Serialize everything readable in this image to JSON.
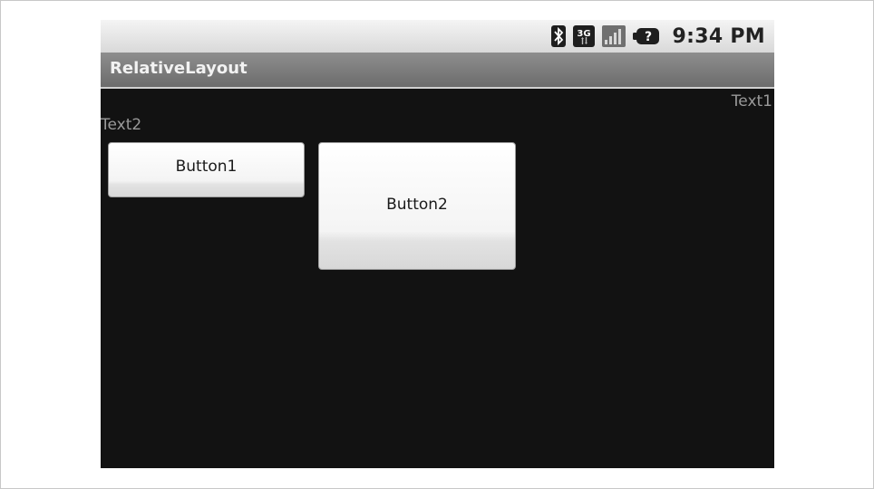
{
  "status_bar": {
    "time": "9:34 PM",
    "icons": [
      "bluetooth-icon",
      "3g-network-icon",
      "signal-strength-icon",
      "battery-unknown-icon"
    ],
    "network_label": "3G"
  },
  "action_bar": {
    "title": "RelativeLayout"
  },
  "content": {
    "text1": "Text1",
    "text2": "Text2",
    "button1_label": "Button1",
    "button2_label": "Button2"
  },
  "colors": {
    "screen_background": "#121212",
    "status_bar": "#e4e4e4",
    "title_bar": "#7d7d7d",
    "text_label": "#9a9a9a",
    "button_face": "#f4f4f4"
  }
}
